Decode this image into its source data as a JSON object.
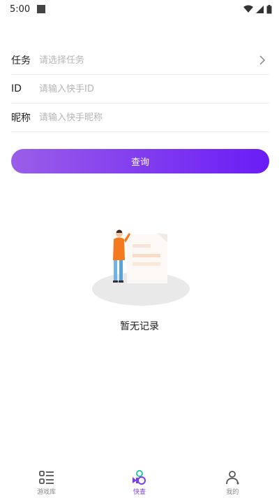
{
  "status_bar": {
    "time": "5:00",
    "icons": [
      "notification-square-icon",
      "wifi-icon",
      "signal-icon",
      "battery-icon"
    ]
  },
  "form": {
    "task": {
      "label": "任务",
      "placeholder": "请选择任务",
      "value": ""
    },
    "id": {
      "label": "ID",
      "placeholder": "请输入快手ID",
      "value": ""
    },
    "nickname": {
      "label": "昵称",
      "placeholder": "请输入快手昵称",
      "value": ""
    }
  },
  "query_button": {
    "label": "查询"
  },
  "empty_state": {
    "text": "暂无记录"
  },
  "tab_bar": {
    "items": [
      {
        "label": "游戏库",
        "icon": "list-icon",
        "active": false
      },
      {
        "label": "快查",
        "icon": "search-glasses-icon",
        "active": true
      },
      {
        "label": "我的",
        "icon": "user-icon",
        "active": false
      }
    ]
  },
  "colors": {
    "accent": "#7b3df0",
    "button_gradient_start": "#9a5ee8",
    "button_gradient_end": "#6a1cf5",
    "active_icon": "#2ec8a6"
  }
}
